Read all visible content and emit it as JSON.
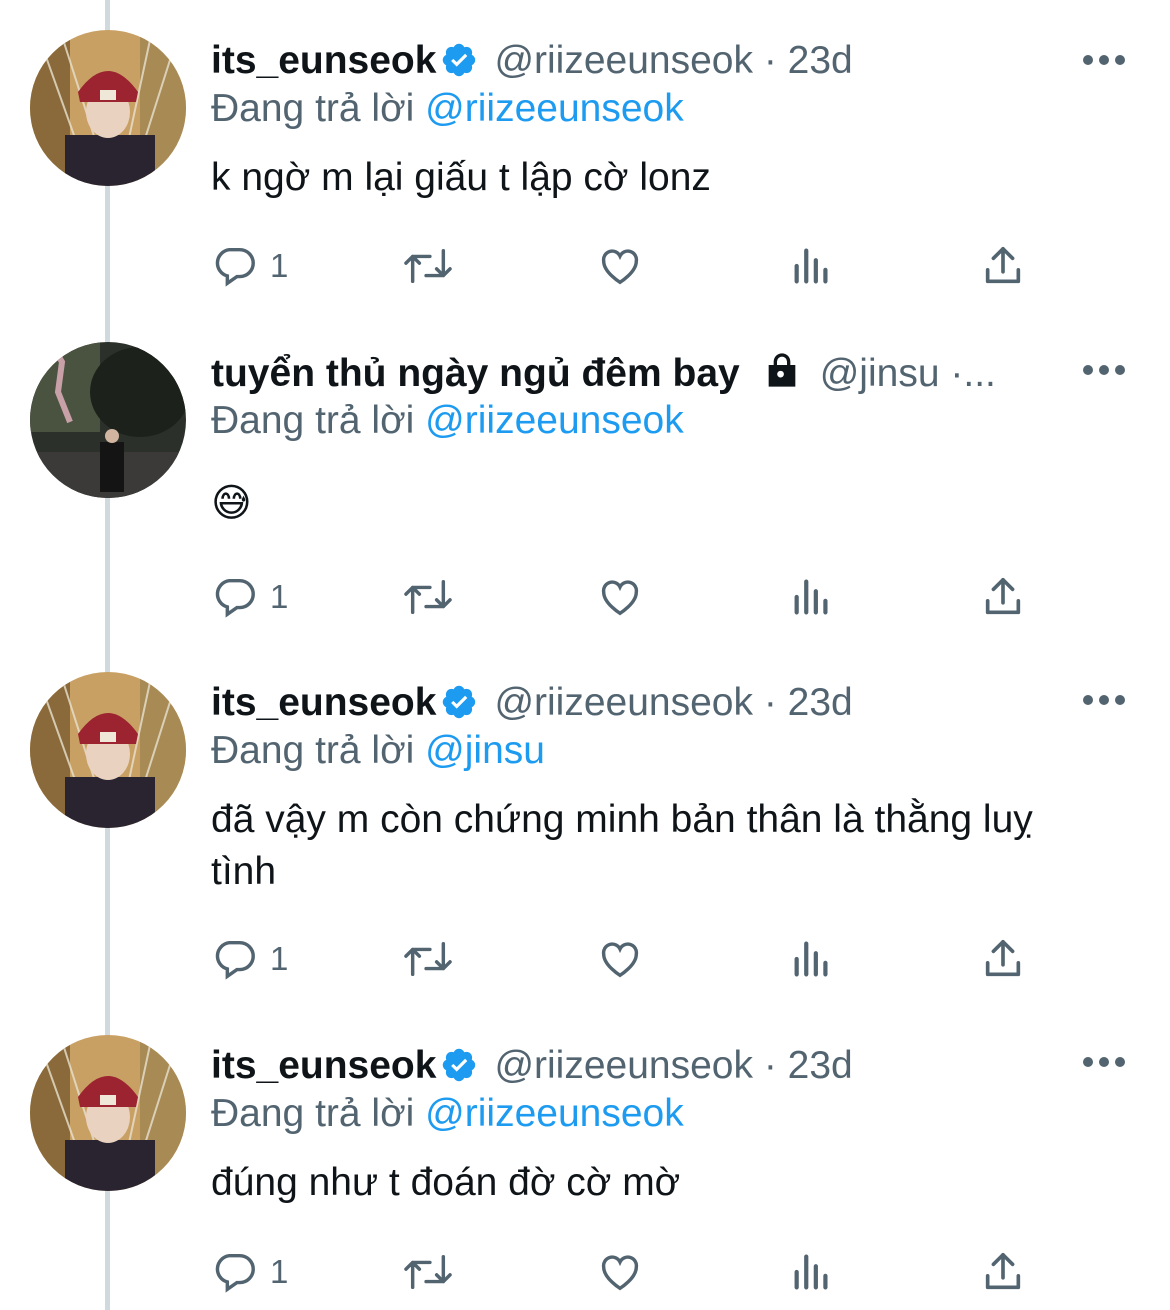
{
  "colors": {
    "text": "#0f1419",
    "secondary": "#536471",
    "link": "#1d9bf0",
    "verified": "#1d9bf0",
    "thread_line": "#cfd9de"
  },
  "tweets": [
    {
      "name": "its_eunseok",
      "verified": true,
      "handle": "@riizeeunseok",
      "separator": "·",
      "time": "23d",
      "reply_prefix": "Đang trả lời",
      "reply_to": "@riizeeunseok",
      "text": "k ngờ m lại giấu t lập cờ lonz",
      "reply_count": "1",
      "icons": [
        "reply-icon",
        "retweet-icon",
        "like-icon",
        "views-icon",
        "share-icon"
      ]
    },
    {
      "name": "tuyển thủ ngày ngủ đêm bay",
      "locked": true,
      "handle": "@jinsu",
      "separator": "·...",
      "reply_prefix": "Đang trả lời",
      "reply_to": "@riizeeunseok",
      "text": "😅",
      "reply_count": "1"
    },
    {
      "name": "its_eunseok",
      "verified": true,
      "handle": "@riizeeunseok",
      "separator": "·",
      "time": "23d",
      "reply_prefix": "Đang trả lời",
      "reply_to": "@jinsu",
      "text": "đã vậy m còn chứng minh bản thân là thằng luỵ tình",
      "reply_count": "1"
    },
    {
      "name": "its_eunseok",
      "verified": true,
      "handle": "@riizeeunseok",
      "separator": "·",
      "time": "23d",
      "reply_prefix": "Đang trả lời",
      "reply_to": "@riizeeunseok",
      "text": "đúng như t đoán đờ cờ mờ",
      "reply_count": "1"
    }
  ]
}
